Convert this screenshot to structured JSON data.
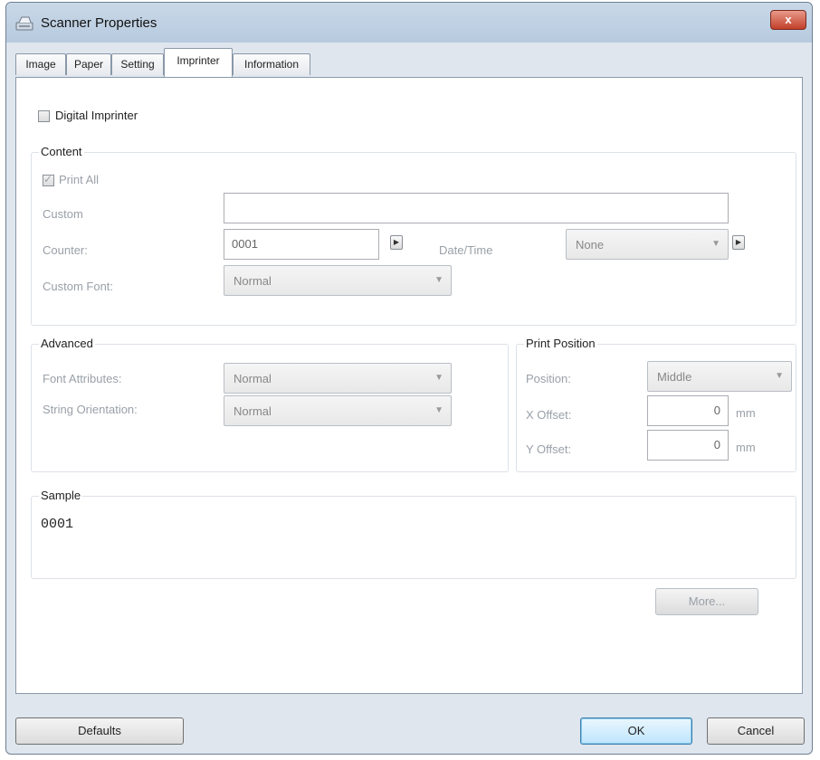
{
  "window": {
    "title": "Scanner Properties",
    "close_label": "x"
  },
  "tabs": [
    {
      "label": "Image"
    },
    {
      "label": "Paper"
    },
    {
      "label": "Setting"
    },
    {
      "label": "Imprinter"
    },
    {
      "label": "Information"
    }
  ],
  "imprinter": {
    "digital_imprinter_label": "Digital Imprinter",
    "digital_imprinter_checked": false,
    "content": {
      "title": "Content",
      "print_all_label": "Print All",
      "print_all_checked": true,
      "custom_label": "Custom",
      "custom_value": "",
      "counter_label": "Counter:",
      "counter_value": "0001",
      "datetime_label": "Date/Time",
      "datetime_value": "None",
      "custom_font_label": "Custom Font:",
      "custom_font_value": "Normal"
    },
    "advanced": {
      "title": "Advanced",
      "font_attributes_label": "Font Attributes:",
      "font_attributes_value": "Normal",
      "string_orientation_label": "String Orientation:",
      "string_orientation_value": "Normal"
    },
    "print_position": {
      "title": "Print Position",
      "position_label": "Position:",
      "position_value": "Middle",
      "x_offset_label": "X Offset:",
      "x_offset_value": "0",
      "x_offset_unit": "mm",
      "y_offset_label": "Y Offset:",
      "y_offset_value": "0",
      "y_offset_unit": "mm"
    },
    "sample": {
      "title": "Sample",
      "text": "0001"
    },
    "more_label": "More..."
  },
  "footer": {
    "defaults_label": "Defaults",
    "ok_label": "OK",
    "cancel_label": "Cancel"
  },
  "icons": {
    "spin": "play-arrow-icon",
    "dropdown": "chevron-down-icon",
    "app": "scanner-icon"
  }
}
